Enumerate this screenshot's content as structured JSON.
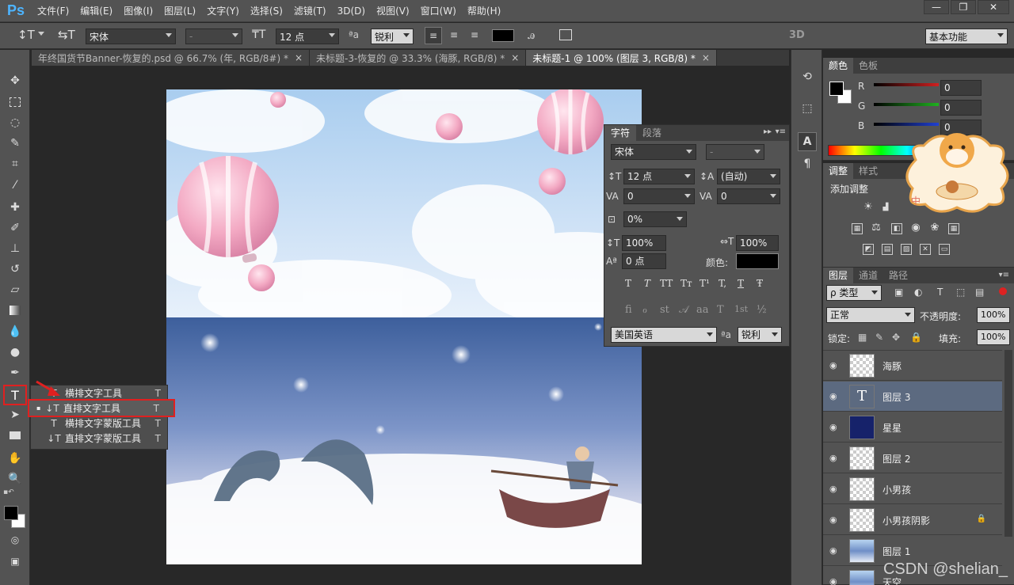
{
  "app": {
    "logo": "Ps"
  },
  "menu": [
    "文件(F)",
    "编辑(E)",
    "图像(I)",
    "图层(L)",
    "文字(Y)",
    "选择(S)",
    "滤镜(T)",
    "3D(D)",
    "视图(V)",
    "窗口(W)",
    "帮助(H)"
  ],
  "window_controls": {
    "minimize": "—",
    "restore": "❐",
    "close": "✕"
  },
  "options": {
    "font_family": "宋体",
    "font_style": "-",
    "font_size": "12 点",
    "aa_icon_text": "ªa",
    "antialias": "锐利",
    "label_3d": "3D",
    "workspace": "基本功能"
  },
  "tabs": [
    {
      "title": "年终国货节Banner-恢复的.psd @ 66.7% (年, RGB/8#) *",
      "close": "×"
    },
    {
      "title": "未标题-3-恢复的 @ 33.3% (海豚, RGB/8) *",
      "close": "×"
    },
    {
      "title": "未标题-1 @ 100% (图层 3, RGB/8) *",
      "close": "×"
    }
  ],
  "tool_flyout": [
    {
      "icon": "T",
      "label": "横排文字工具",
      "key": "T"
    },
    {
      "icon": "↓T",
      "label": "直排文字工具",
      "key": "T",
      "selected_mark": "▪"
    },
    {
      "icon": "T",
      "label": "横排文字蒙版工具",
      "key": "T"
    },
    {
      "icon": "↓T",
      "label": "直排文字蒙版工具",
      "key": "T"
    }
  ],
  "char_panel": {
    "tabs": [
      "字符",
      "段落"
    ],
    "font_family": "宋体",
    "font_style": "-",
    "size": "12 点",
    "leading": "(自动)",
    "kerning": "0",
    "tracking": "0",
    "tsume": "0%",
    "vscale": "100%",
    "hscale": "100%",
    "baseline": "0 点",
    "color_label": "颜色:",
    "styles": [
      "T",
      "T",
      "TT",
      "Tт",
      "T¹",
      "T,",
      "T",
      "Ŧ"
    ],
    "ligatures": [
      "ﬁ",
      "ℴ",
      "st",
      "𝒜",
      "aa",
      "T",
      "1st",
      "½"
    ],
    "language": "美国英语",
    "aa_icon_text": "ªa",
    "antialias": "锐利"
  },
  "color_panel": {
    "tabs": [
      "颜色",
      "色板"
    ],
    "channels": [
      {
        "label": "R",
        "value": "0",
        "color": "#d02020"
      },
      {
        "label": "G",
        "value": "0",
        "color": "#20b020"
      },
      {
        "label": "B",
        "value": "0",
        "color": "#2040d0"
      }
    ]
  },
  "adjust_panel": {
    "tabs": [
      "调整",
      "样式"
    ],
    "add_label": "添加调整"
  },
  "layers_panel": {
    "tabs": [
      "图层",
      "通道",
      "路径"
    ],
    "filter_label": "ρ 类型",
    "blend_mode": "正常",
    "opacity_label": "不透明度:",
    "opacity": "100%",
    "lock_label": "锁定:",
    "fill_label": "填充:",
    "fill": "100%",
    "layers": [
      {
        "name": "海豚",
        "selected": false,
        "locked": false,
        "thumb": "transparent"
      },
      {
        "name": "图层 3",
        "selected": true,
        "locked": false,
        "thumb": "text"
      },
      {
        "name": "星星",
        "selected": false,
        "locked": false,
        "thumb": "stars"
      },
      {
        "name": "图层 2",
        "selected": false,
        "locked": false,
        "thumb": "transparent"
      },
      {
        "name": "小男孩",
        "selected": false,
        "locked": false,
        "thumb": "transparent"
      },
      {
        "name": "小男孩阴影",
        "selected": false,
        "locked": true,
        "thumb": "transparent"
      },
      {
        "name": "图层 1",
        "selected": false,
        "locked": false,
        "thumb": "sky"
      },
      {
        "name": "天空",
        "selected": false,
        "locked": false,
        "thumb": "sky"
      }
    ]
  },
  "sticker": {
    "text": "中"
  },
  "watermark": "CSDN @shelian_"
}
